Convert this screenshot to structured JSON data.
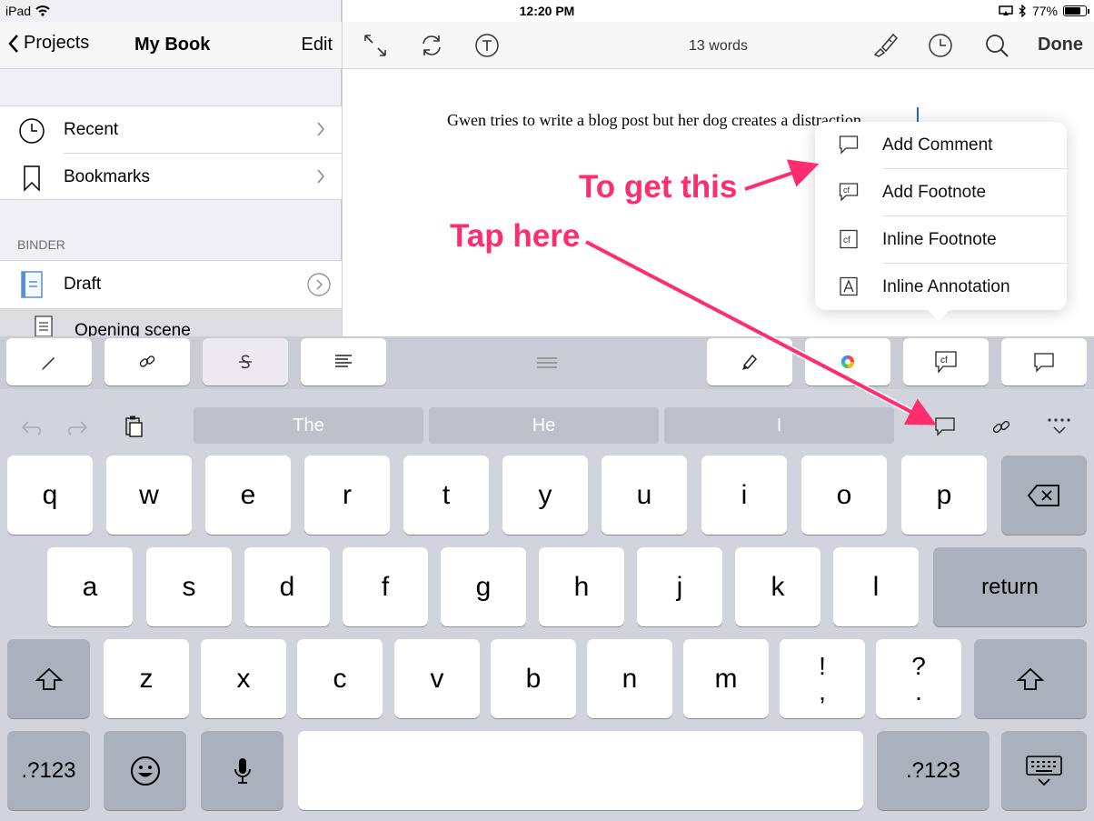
{
  "status": {
    "device": "iPad",
    "time": "12:20 PM",
    "battery": "77%",
    "battery_level": 0.77
  },
  "sidebar": {
    "back_label": "Projects",
    "title": "My Book",
    "edit_label": "Edit",
    "items": [
      {
        "label": "Recent"
      },
      {
        "label": "Bookmarks"
      }
    ],
    "binder_header": "BINDER",
    "binder_items": [
      {
        "label": "Draft"
      },
      {
        "label": "Opening scene"
      }
    ]
  },
  "editor": {
    "word_count": "13 words",
    "done_label": "Done",
    "text": "Gwen tries to write a blog post but her dog creates a distraction."
  },
  "popup_menu": {
    "items": [
      {
        "label": "Add Comment",
        "icon": "comment-icon"
      },
      {
        "label": "Add Footnote",
        "icon": "footnote-icon"
      },
      {
        "label": "Inline Footnote",
        "icon": "inline-footnote-icon"
      },
      {
        "label": "Inline Annotation",
        "icon": "inline-annotation-icon"
      }
    ]
  },
  "toolbar": {
    "footnote_glyph": "cf",
    "suggestions": [
      "The",
      "He",
      "I"
    ]
  },
  "keyboard": {
    "row1": [
      "q",
      "w",
      "e",
      "r",
      "t",
      "y",
      "u",
      "i",
      "o",
      "p"
    ],
    "row2": [
      "a",
      "s",
      "d",
      "f",
      "g",
      "h",
      "j",
      "k",
      "l"
    ],
    "row3": [
      "z",
      "x",
      "c",
      "v",
      "b",
      "n",
      "m"
    ],
    "punct1": {
      "top": "!",
      "bottom": ","
    },
    "punct2": {
      "top": "?",
      "bottom": "."
    },
    "return_label": "return",
    "numbers_label": ".?123"
  },
  "annotations": {
    "top": "To get this",
    "bottom": "Tap here"
  },
  "colors": {
    "annotation": "#ff2d6e",
    "cursor": "#1f5fff"
  }
}
